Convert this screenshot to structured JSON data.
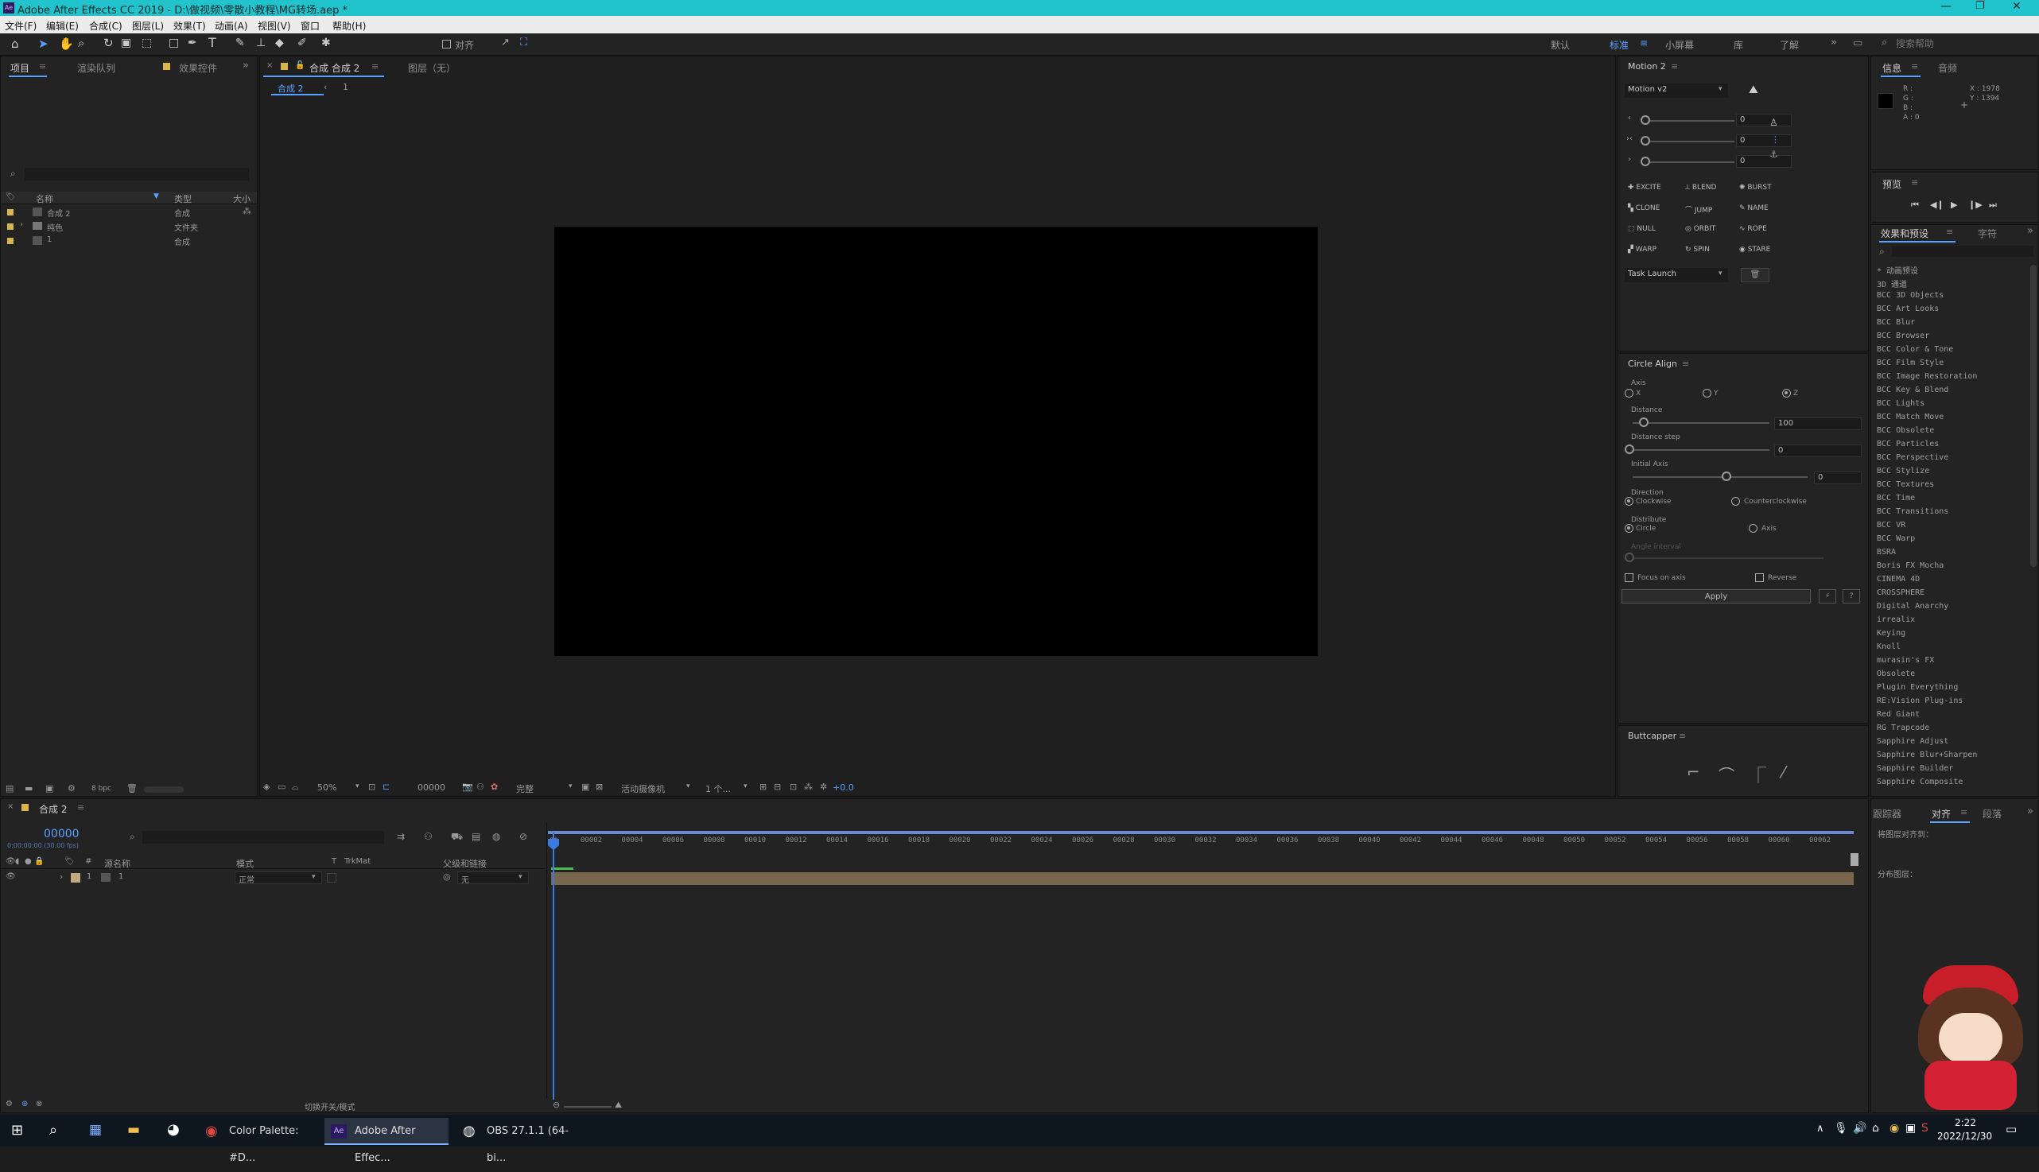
{
  "window": {
    "title": "Adobe After Effects CC 2019 - D:\\做视频\\零散小教程\\MG转场.aep *"
  },
  "menu": [
    "文件(F)",
    "编辑(E)",
    "合成(C)",
    "图层(L)",
    "效果(T)",
    "动画(A)",
    "视图(V)",
    "窗口",
    "帮助(H)"
  ],
  "toolbar": {
    "align_label": "对齐",
    "workspaces": [
      "默认",
      "标准",
      "小屏幕",
      "库",
      "了解"
    ],
    "search_placeholder": "搜索帮助"
  },
  "project_panel": {
    "tabs": [
      "项目",
      "渲染队列",
      "效果控件"
    ],
    "columns": {
      "name": "名称",
      "type": "类型",
      "size": "大小"
    },
    "items": [
      {
        "name": "合成 2",
        "type": "合成",
        "color": "#d9b64a"
      },
      {
        "name": "纯色",
        "type": "文件夹",
        "color": "#d9b64a"
      },
      {
        "name": "1",
        "type": "合成",
        "color": "#d9b64a"
      }
    ],
    "bpc": "8 bpc"
  },
  "comp_panel": {
    "tab": "合成 合成 2",
    "layer_tab": "图层（无）",
    "breadcrumb": [
      "合成 2",
      "1"
    ],
    "zoom": "50%",
    "timecode": "00000",
    "quality": "完整",
    "camera": "活动摄像机",
    "views": "1 个...",
    "exposure": "+0.0"
  },
  "motion_panel": {
    "title": "Motion 2",
    "version": "Motion v2",
    "slider_values": [
      "0",
      "0",
      "0"
    ],
    "buttons": [
      "EXCITE",
      "BLEND",
      "BURST",
      "CLONE",
      "JUMP",
      "NAME",
      "NULL",
      "ORBIT",
      "ROPE",
      "WARP",
      "SPIN",
      "STARE"
    ],
    "task": "Task Launch"
  },
  "circle_align": {
    "title": "Circle Align",
    "axis_label": "Axis",
    "axes": [
      "X",
      "Y",
      "Z"
    ],
    "distance_label": "Distance",
    "distance_value": "100",
    "distance_step_label": "Distance step",
    "distance_step_value": "0",
    "initial_axis_label": "Initial Axis",
    "initial_axis_value": "0",
    "direction_label": "Direction",
    "clockwise": "Clockwise",
    "counterclockwise": "Counterclockwise",
    "distribute_label": "Distribute",
    "circle": "Circle",
    "axis_opt": "Axis",
    "angle_label": "Angle interval",
    "focus_label": "Focus on axis",
    "reverse_label": "Reverse",
    "apply_label": "Apply"
  },
  "buttcapper": {
    "title": "Buttcapper"
  },
  "info_panel": {
    "tabs": [
      "信息",
      "音频"
    ],
    "rgba": [
      "R :",
      "G :",
      "B :",
      "A : 0"
    ],
    "x": "X : 1978",
    "y": "Y : 1394"
  },
  "preview_panel": {
    "title": "预览"
  },
  "effects_panel": {
    "tabs": [
      "效果和预设",
      "字符"
    ],
    "items": [
      "* 动画预设",
      "3D 通道",
      "BCC 3D Objects",
      "BCC Art Looks",
      "BCC Blur",
      "BCC Browser",
      "BCC Color & Tone",
      "BCC Film Style",
      "BCC Image Restoration",
      "BCC Key & Blend",
      "BCC Lights",
      "BCC Match Move",
      "BCC Obsolete",
      "BCC Particles",
      "BCC Perspective",
      "BCC Stylize",
      "BCC Textures",
      "BCC Time",
      "BCC Transitions",
      "BCC VR",
      "BCC Warp",
      "BSRA",
      "Boris FX Mocha",
      "CINEMA 4D",
      "CROSSPHERE",
      "Digital Anarchy",
      "irrealix",
      "Keying",
      "Knoll",
      "murasin's FX",
      "Obsolete",
      "Plugin Everything",
      "RE:Vision Plug-ins",
      "Red Giant",
      "RG Trapcode",
      "Sapphire Adjust",
      "Sapphire Blur+Sharpen",
      "Sapphire Builder",
      "Sapphire Composite"
    ]
  },
  "timeline": {
    "tab": "合成 2",
    "timecode": "00000",
    "timecode_sub": "0:00:00:00 (30.00 fps)",
    "columns": {
      "num": "#",
      "layer_name": "源名称",
      "mode": "模式",
      "t": "T",
      "trkmat": "TrkMat",
      "parent": "父级和链接"
    },
    "layer": {
      "num": "1",
      "name": "1",
      "mode": "正常",
      "parent": "无"
    },
    "ticks": [
      "00002",
      "00004",
      "00006",
      "00008",
      "00010",
      "00012",
      "00014",
      "00016",
      "00018",
      "00020",
      "00022",
      "00024",
      "00026",
      "00028",
      "00030",
      "00032",
      "00034",
      "00036",
      "00038",
      "00040",
      "00042",
      "00044",
      "00046",
      "00048",
      "00050",
      "00052",
      "00054",
      "00056",
      "00058",
      "00060",
      "00062"
    ],
    "footer": "切换开关/模式",
    "start_tick": "00"
  },
  "align_panel": {
    "tabs": [
      "跟踪器",
      "对齐",
      "段落"
    ],
    "align_to": "将图层对齐到：",
    "distribute": "分布图层："
  },
  "taskbar": {
    "apps": [
      "Color Palette: #D...",
      "Adobe After Effec...",
      "OBS 27.1.1 (64-bi..."
    ],
    "time": "2:22",
    "date": "2022/12/30"
  }
}
